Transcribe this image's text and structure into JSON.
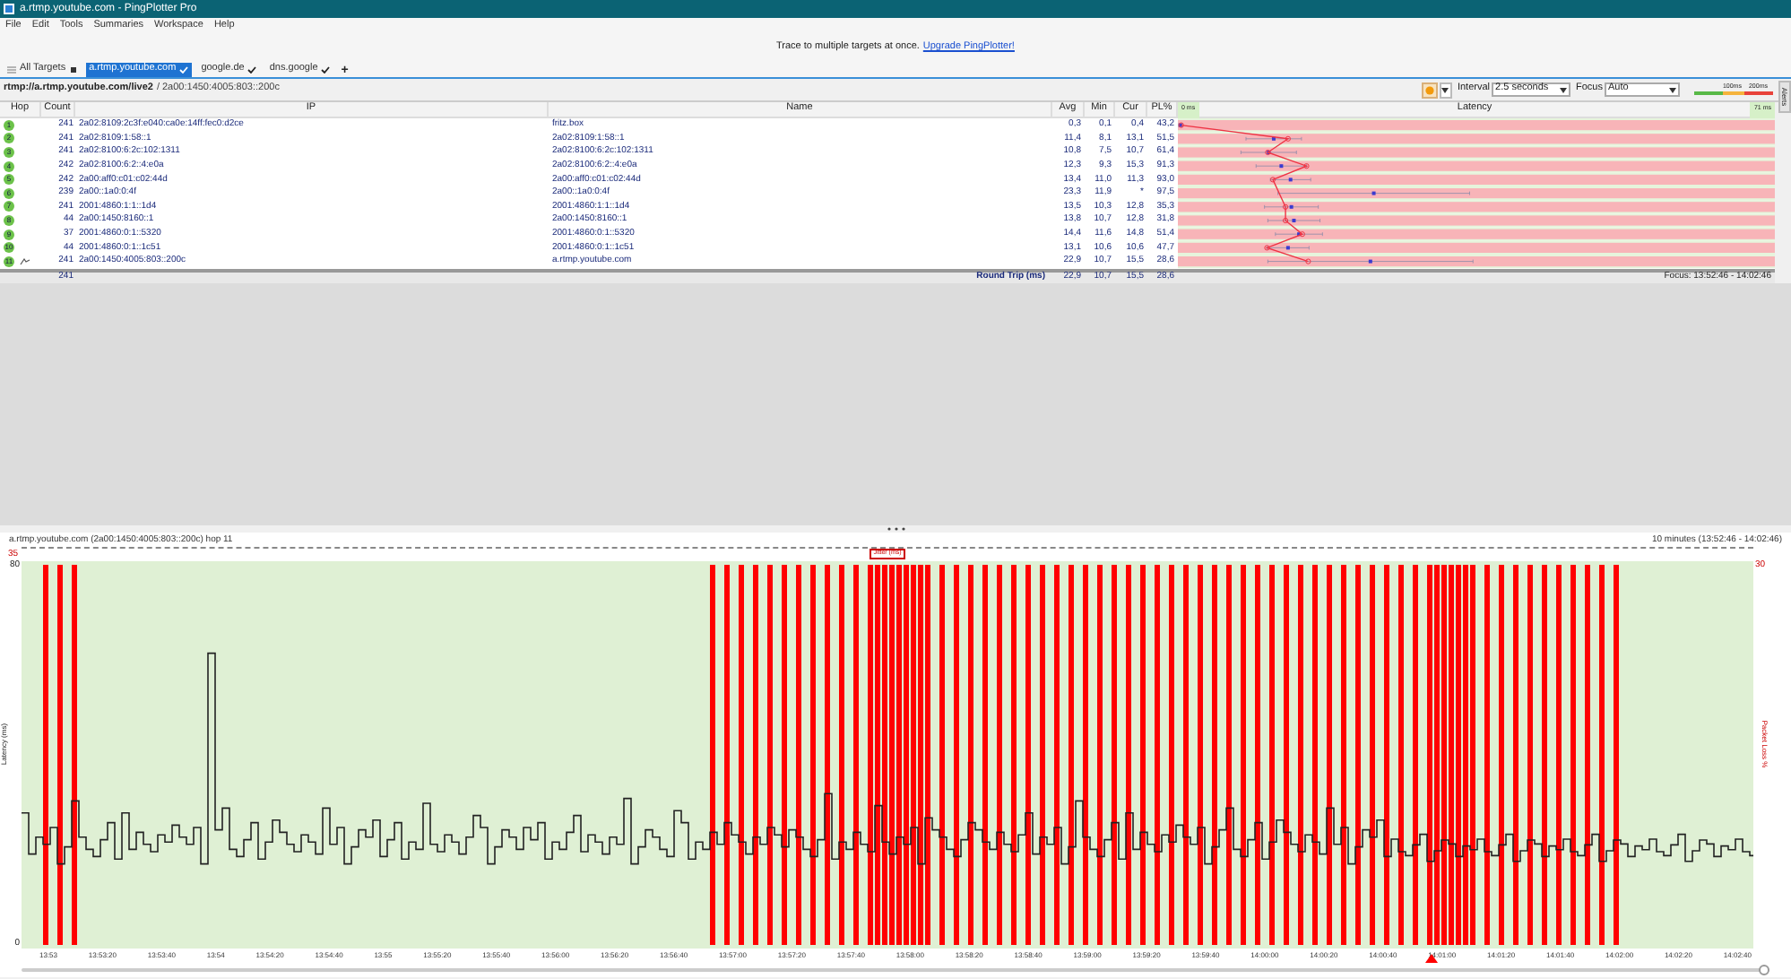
{
  "window": {
    "title": "a.rtmp.youtube.com - PingPlotter Pro"
  },
  "menu": [
    "File",
    "Edit",
    "Tools",
    "Summaries",
    "Workspace",
    "Help"
  ],
  "banner": {
    "text": "Trace to multiple targets at once.",
    "link": "Upgrade PingPlotter!"
  },
  "tabs": [
    {
      "label": "All Targets",
      "selected": false,
      "kind": "all"
    },
    {
      "label": "a.rtmp.youtube.com",
      "selected": true,
      "kind": "target"
    },
    {
      "label": "google.de",
      "selected": false,
      "kind": "target"
    },
    {
      "label": "dns.google",
      "selected": false,
      "kind": "target"
    }
  ],
  "add_tab": "+",
  "target_path": {
    "url": "rtmp://a.rtmp.youtube.com/live2",
    "ip": "/ 2a00:1450:4005:803::200c"
  },
  "toolbar": {
    "interval_label": "Interval",
    "interval": "2.5 seconds",
    "focus_label": "Focus",
    "focus": "Auto",
    "scale_labels": [
      "100ms",
      "200ms"
    ]
  },
  "side_tab": "Alerts",
  "table": {
    "columns": [
      "Hop",
      "Count",
      "IP",
      "Name",
      "Avg",
      "Min",
      "Cur",
      "PL%",
      "Latency"
    ],
    "latency_min": "0 ms",
    "latency_max": "71 ms",
    "rows": [
      {
        "hop": "1",
        "count": "241",
        "ip": "2a02:8109:2c3f:e040:ca0e:14ff:fec0:d2ce",
        "name": "fritz.box",
        "avg": "0,3",
        "min": "0,1",
        "cur": "0,4",
        "pl": "43,2",
        "destination": false
      },
      {
        "hop": "2",
        "count": "241",
        "ip": "2a02:8109:1:58::1",
        "name": "2a02:8109:1:58::1",
        "avg": "11,4",
        "min": "8,1",
        "cur": "13,1",
        "pl": "51,5",
        "destination": false
      },
      {
        "hop": "3",
        "count": "241",
        "ip": "2a02:8100:6:2c:102:1311",
        "name": "2a02:8100:6:2c:102:1311",
        "avg": "10,8",
        "min": "7,5",
        "cur": "10,7",
        "pl": "61,4",
        "destination": false
      },
      {
        "hop": "4",
        "count": "242",
        "ip": "2a02:8100:6:2::4:e0a",
        "name": "2a02:8100:6:2::4:e0a",
        "avg": "12,3",
        "min": "9,3",
        "cur": "15,3",
        "pl": "91,3",
        "destination": false
      },
      {
        "hop": "5",
        "count": "242",
        "ip": "2a00:aff0:c01:c02:44d",
        "name": "2a00:aff0:c01:c02:44d",
        "avg": "13,4",
        "min": "11,0",
        "cur": "11,3",
        "pl": "93,0",
        "destination": false
      },
      {
        "hop": "6",
        "count": "239",
        "ip": "2a00::1a0:0:4f",
        "name": "2a00::1a0:0:4f",
        "avg": "23,3",
        "min": "11,9",
        "cur": "*",
        "pl": "97,5",
        "destination": false
      },
      {
        "hop": "7",
        "count": "241",
        "ip": "2001:4860:1:1::1d4",
        "name": "2001:4860:1:1::1d4",
        "avg": "13,5",
        "min": "10,3",
        "cur": "12,8",
        "pl": "35,3",
        "destination": false
      },
      {
        "hop": "8",
        "count": "44",
        "ip": "2a00:1450:8160::1",
        "name": "2a00:1450:8160::1",
        "avg": "13,8",
        "min": "10,7",
        "cur": "12,8",
        "pl": "31,8",
        "destination": false
      },
      {
        "hop": "9",
        "count": "37",
        "ip": "2001:4860:0:1::5320",
        "name": "2001:4860:0:1::5320",
        "avg": "14,4",
        "min": "11,6",
        "cur": "14,8",
        "pl": "51,4",
        "destination": false
      },
      {
        "hop": "10",
        "count": "44",
        "ip": "2001:4860:0:1::1c51",
        "name": "2001:4860:0:1::1c51",
        "avg": "13,1",
        "min": "10,6",
        "cur": "10,6",
        "pl": "47,7",
        "destination": false
      },
      {
        "hop": "11",
        "count": "241",
        "ip": "2a00:1450:4005:803::200c",
        "name": "a.rtmp.youtube.com",
        "avg": "22,9",
        "min": "10,7",
        "cur": "15,5",
        "pl": "28,6",
        "destination": true
      }
    ],
    "summary": {
      "count": "241",
      "label": "Round Trip (ms)",
      "avg": "22,9",
      "min": "10,7",
      "cur": "15,5",
      "pl": "28,6",
      "focus": "Focus: 13:52:46 - 14:02:46"
    }
  },
  "timeline": {
    "title": "a.rtmp.youtube.com (2a00:1450:4005:803::200c) hop 11",
    "range": "10 minutes (13:52:46 - 14:02:46)",
    "jitter_label": "Jitter (ms)",
    "jitter_max": "35",
    "latency_max": "80",
    "latency_min": "0",
    "loss_max": "30",
    "ylabel": "Latency (ms)",
    "y2label": "Packet Loss %",
    "slider": {
      "level": 1
    },
    "times": [
      "13:53",
      "13:53:20",
      "13:53:40",
      "13:54",
      "13:54:20",
      "13:54:40",
      "13:55",
      "13:55:20",
      "13:55:40",
      "13:56:00",
      "13:56:20",
      "13:56:40",
      "13:57:00",
      "13:57:20",
      "13:57:40",
      "13:58:00",
      "13:58:20",
      "13:58:40",
      "13:59:00",
      "13:59:20",
      "13:59:40",
      "14:00:00",
      "14:00:20",
      "14:00:40",
      "14:01:00",
      "14:01:20",
      "14:01:40",
      "14:02:00",
      "14:02:20",
      "14:02:40"
    ]
  }
}
